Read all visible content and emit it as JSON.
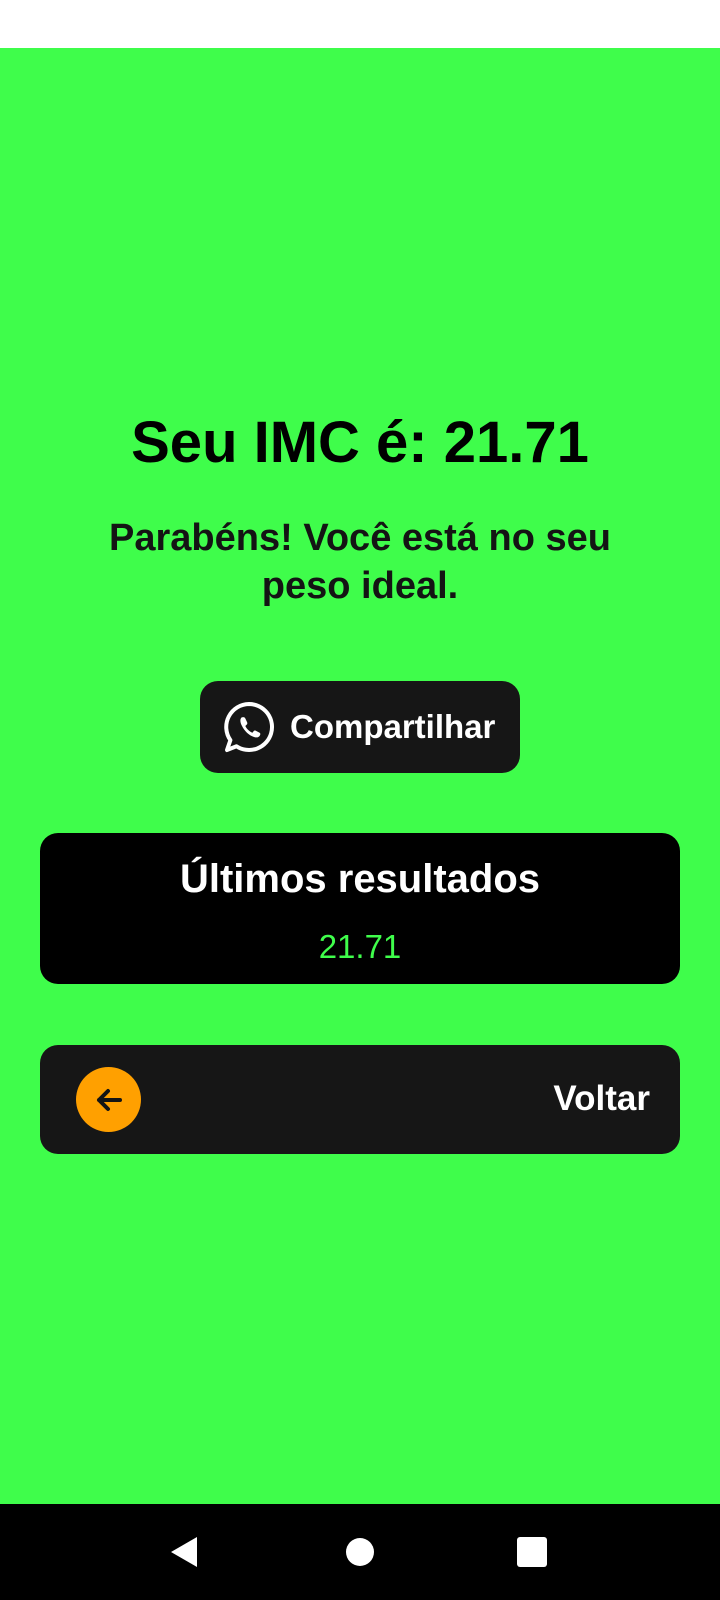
{
  "theme": {
    "background": "#3ffd4b",
    "dark_surface": "#161616",
    "card_surface": "#000000",
    "accent": "#ffa000",
    "result_value_color": "#3ffd4b"
  },
  "result": {
    "title": "Seu IMC é: 21.71",
    "message": "Parabéns! Você está no seu peso ideal."
  },
  "share": {
    "icon": "whatsapp-icon",
    "label": "Compartilhar"
  },
  "history": {
    "heading": "Últimos resultados",
    "values": [
      "21.71"
    ]
  },
  "back": {
    "icon": "arrow-left-icon",
    "label": "Voltar"
  },
  "navigation": {
    "back_icon": "triangle-back-icon",
    "home_icon": "circle-home-icon",
    "recents_icon": "square-recents-icon"
  }
}
